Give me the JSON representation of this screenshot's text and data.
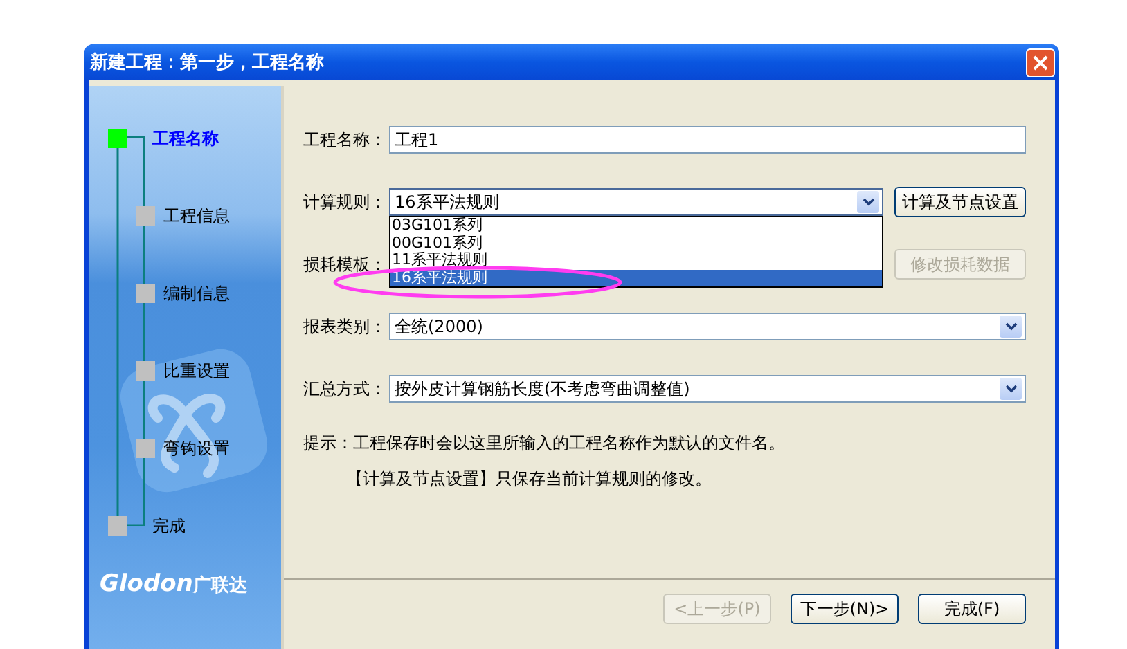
{
  "window": {
    "title": "新建工程：第一步，工程名称"
  },
  "steps": [
    {
      "label": "工程名称",
      "selected": true,
      "children": [
        {
          "label": "工程信息",
          "selected": false
        },
        {
          "label": "编制信息",
          "selected": false
        },
        {
          "label": "比重设置",
          "selected": false
        },
        {
          "label": "弯钩设置",
          "selected": false
        }
      ]
    },
    {
      "label": "完成",
      "selected": false
    }
  ],
  "logo": {
    "latin": "Glodon",
    "chinese": "广联达"
  },
  "fields": [
    {
      "kind": "text",
      "label": "工程名称：",
      "value": "工程1"
    },
    {
      "kind": "combo",
      "label": "计算规则：",
      "value": "16系平法规则",
      "expanded": true,
      "options": [
        {
          "label": "03G101系列",
          "selected": false
        },
        {
          "label": "00G101系列",
          "selected": false
        },
        {
          "label": "11系平法规则",
          "selected": false
        },
        {
          "label": "16系平法规则",
          "selected": true
        }
      ],
      "button": {
        "label": "计算及节点设置",
        "disabled": false
      }
    },
    {
      "kind": "covered",
      "label": "损耗模板：",
      "button": {
        "label": "修改损耗数据",
        "disabled": true
      }
    },
    {
      "kind": "combo",
      "label": "报表类别：",
      "value": "全统(2000)",
      "expanded": false
    },
    {
      "kind": "combo",
      "label": "汇总方式：",
      "value": "按外皮计算钢筋长度(不考虑弯曲调整值)",
      "expanded": false
    }
  ],
  "hints": [
    {
      "text": "提示：工程保存时会以这里所输入的工程名称作为默认的文件名。",
      "indented": false
    },
    {
      "text": "【计算及节点设置】只保存当前计算规则的修改。",
      "indented": true
    }
  ],
  "buttons": [
    {
      "label": "<上一步(P)",
      "disabled": true
    },
    {
      "label": "下一步(N)>",
      "disabled": false
    },
    {
      "label": "完成(F)",
      "disabled": false
    }
  ]
}
